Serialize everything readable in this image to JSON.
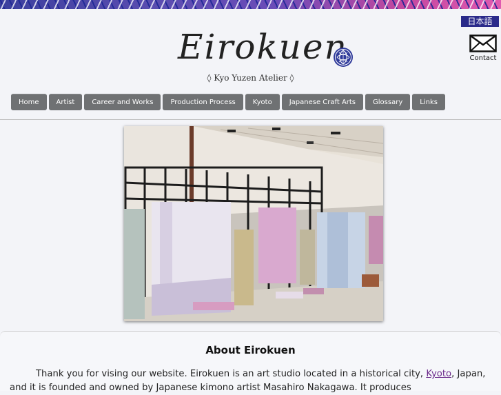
{
  "header": {
    "language_button": "日本語",
    "contact_label": "Contact",
    "logo_text": "Eirokuen",
    "subtitle": "◊ Kyo Yuzen Atelier ◊"
  },
  "nav": {
    "items": [
      {
        "label": "Home"
      },
      {
        "label": "Artist"
      },
      {
        "label": "Career and Works"
      },
      {
        "label": "Production Process"
      },
      {
        "label": "Kyoto"
      },
      {
        "label": "Japanese Craft Arts"
      },
      {
        "label": "Glossary"
      },
      {
        "label": "Links"
      }
    ]
  },
  "about": {
    "title": "About Eirokuen",
    "text_before_link": "Thank you for vising our website. Eirokuen is an art studio located in a historical city, ",
    "link_text": "Kyoto",
    "text_after_link": ", Japan, and it is founded and owned by Japanese kimono artist Masahiro Nakagawa. It produces"
  },
  "colors": {
    "nav_bg": "#6f7173",
    "language_bg": "#2a2a8a",
    "link": "#6b2a8a",
    "page_bg": "#f3f4f8"
  }
}
